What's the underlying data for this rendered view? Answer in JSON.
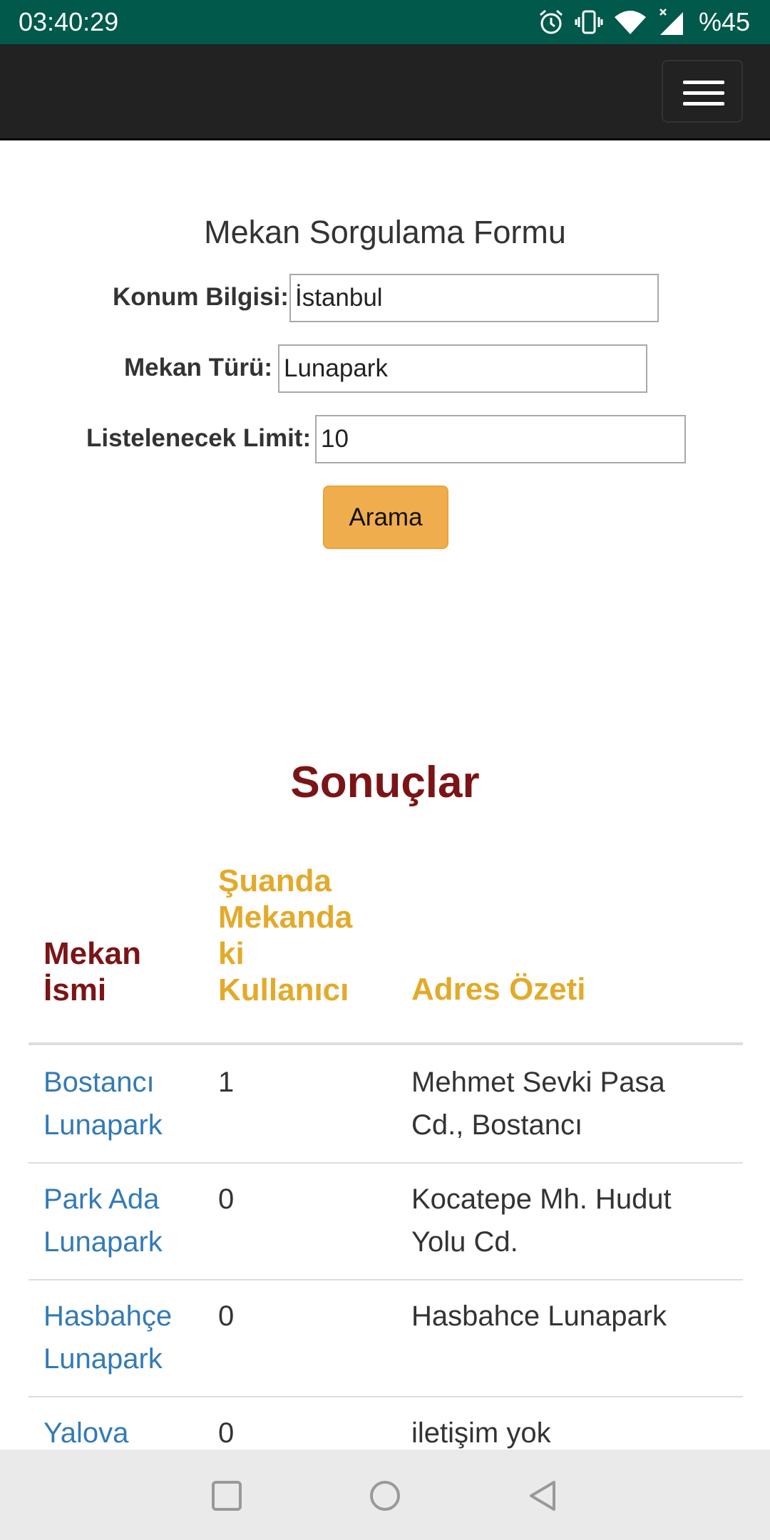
{
  "status_bar": {
    "time": "03:40:29",
    "battery": "%45",
    "icons": [
      "alarm-icon",
      "vibrate-icon",
      "wifi-icon",
      "cellular-signal-icon"
    ]
  },
  "navbar": {
    "menu_icon": "hamburger-menu-icon"
  },
  "form": {
    "title": "Mekan Sorgulama Formu",
    "location_label": "Konum Bilgisi:",
    "location_value": "İstanbul",
    "type_label": "Mekan Türü:",
    "type_value": "Lunapark",
    "limit_label": "Listelenecek Limit:",
    "limit_value": "10",
    "search_button": "Arama"
  },
  "results": {
    "title": "Sonuçlar",
    "headers": {
      "name_line1": "Mekan",
      "name_line2": "İsmi",
      "users_line1": "Şuanda",
      "users_line2": "Mekanda",
      "users_line3": "ki",
      "users_line4": "Kullanıcı",
      "address": "Adres Özeti"
    },
    "rows": [
      {
        "name_line1": "Bostancı",
        "name_line2": "Lunapark",
        "users": "1",
        "addr_line1": "Mehmet Sevki Pasa",
        "addr_line2": "Cd., Bostancı"
      },
      {
        "name_line1": "Park Ada",
        "name_line2": "Lunapark",
        "users": "0",
        "addr_line1": "Kocatepe Mh. Hudut",
        "addr_line2": "Yolu Cd."
      },
      {
        "name_line1": "Hasbahçe",
        "name_line2": "Lunapark",
        "users": "0",
        "addr_line1": "Hasbahce Lunapark",
        "addr_line2": ""
      },
      {
        "name_line1": "Yalova",
        "name_line2": "",
        "users": "0",
        "addr_line1": "iletişim yok",
        "addr_line2": ""
      }
    ]
  },
  "colors": {
    "status_bar": "#00594a",
    "navbar": "#222222",
    "button": "#f0ad4e",
    "results_title": "#7b1416",
    "header_gold": "#e3aa2a",
    "link": "#337ab7"
  },
  "system_nav": {
    "buttons": [
      "recents-square-icon",
      "home-circle-icon",
      "back-triangle-icon"
    ]
  }
}
